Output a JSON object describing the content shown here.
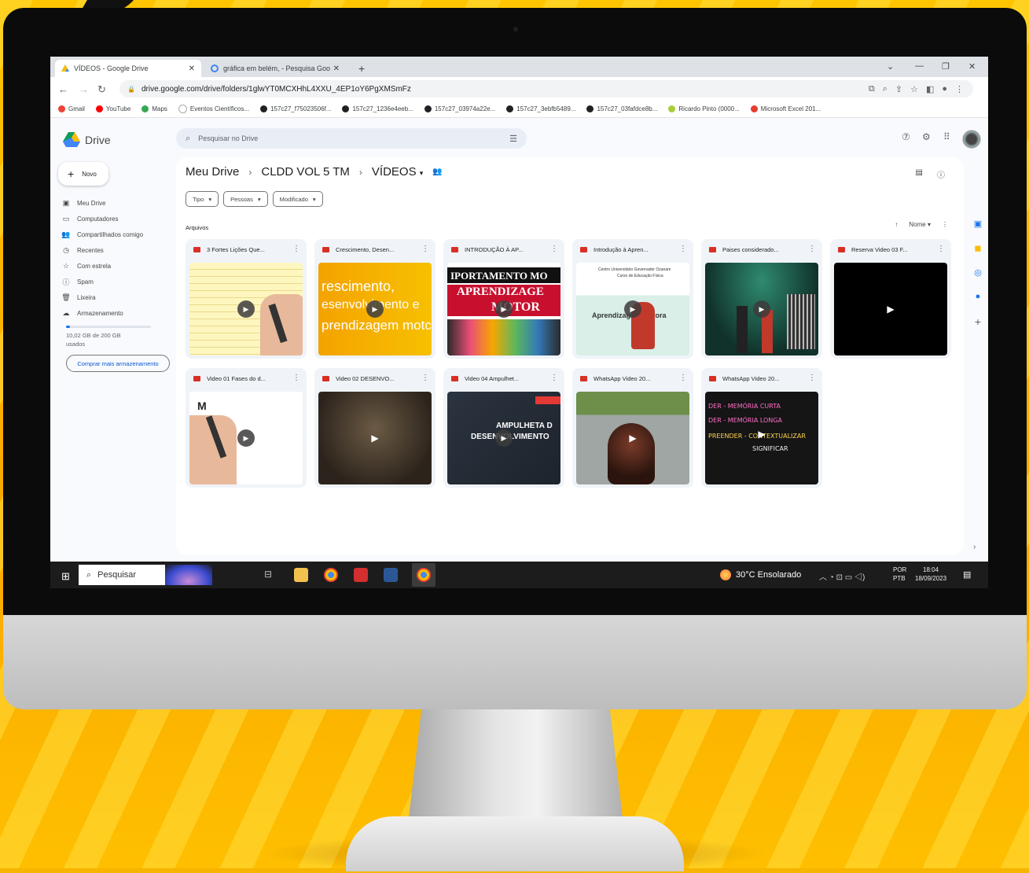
{
  "browser": {
    "tabs": [
      {
        "label": "VÍDEOS - Google Drive",
        "active": true
      },
      {
        "label": "gráfica em belém, - Pesquisa Goo",
        "active": false
      }
    ],
    "new_tab": "+",
    "url": "drive.google.com/drive/folders/1glwYT0MCXHhL4XXU_4EP1oY6PgXMSmFz",
    "bookmarks": [
      {
        "label": "Gmail",
        "color": "#ea4335"
      },
      {
        "label": "YouTube",
        "color": "#ff0000"
      },
      {
        "label": "Maps",
        "color": "#34a853"
      },
      {
        "label": "Eventos Científicos...",
        "color": "#ffffff"
      },
      {
        "label": "157c27_f75023506f...",
        "color": "#202124"
      },
      {
        "label": "157c27_1236e4eeb...",
        "color": "#202124"
      },
      {
        "label": "157c27_03974a22e...",
        "color": "#202124"
      },
      {
        "label": "157c27_3ebfb5489...",
        "color": "#202124"
      },
      {
        "label": "157c27_03fafdce8b...",
        "color": "#202124"
      },
      {
        "label": "Ricardo Pinto (0000...",
        "color": "#a6ce39"
      },
      {
        "label": "Microsoft Excel 201...",
        "color": "#e63d2e"
      }
    ]
  },
  "drive": {
    "logo_text": "Drive",
    "search_placeholder": "Pesquisar no Drive",
    "new_label": "Novo",
    "sidebar": [
      {
        "label": "Meu Drive",
        "icon": "▣"
      },
      {
        "label": "Computadores",
        "icon": "▭"
      },
      {
        "label": "Compartilhados comigo",
        "icon": "👥"
      },
      {
        "label": "Recentes",
        "icon": "◷"
      },
      {
        "label": "Com estrela",
        "icon": "☆"
      },
      {
        "label": "Spam",
        "icon": "ⓘ"
      },
      {
        "label": "Lixeira",
        "icon": "🗑"
      },
      {
        "label": "Armazenamento",
        "icon": "☁"
      }
    ],
    "storage_used_fraction": 0.05,
    "storage_text": "10,02 GB de 200 GB usados",
    "buy_storage": "Comprar mais armazenamento",
    "breadcrumb": [
      "Meu Drive",
      "CLDD VOL 5 TM",
      "VÍDEOS"
    ],
    "filters": [
      "Tipo",
      "Pessoas",
      "Modificado"
    ],
    "section_label": "Arquivos",
    "sort_label": "Nome",
    "files": [
      {
        "title": "3 Fortes Lições Que..."
      },
      {
        "title": "Crescimento, Desen..."
      },
      {
        "title": "INTRODUÇÃO À AP..."
      },
      {
        "title": "Introdução à Apren..."
      },
      {
        "title": "Paises considerado..."
      },
      {
        "title": "Reserva Video 03 F..."
      },
      {
        "title": "Video 01 Fases do d..."
      },
      {
        "title": "Video 02 DESENVO..."
      },
      {
        "title": "Video 04 Ampulhet..."
      },
      {
        "title": "WhatsApp Video 20..."
      },
      {
        "title": "WhatsApp Video 20..."
      }
    ],
    "thumb_texts": {
      "crescimento": [
        "rescimento,",
        "esenvolvimento e",
        "prendizagem motc"
      ],
      "intro_ap": [
        "IPORTAMENTO MO",
        "APRENDIZAGE",
        "MOTOR"
      ],
      "intro_apren": [
        "Centro Universitário Governador Ozanam",
        "Curso de Educação Física",
        "Aprendizagem Motora"
      ],
      "ampulheta": [
        "AMPULHETA D",
        "DESENVOLVIMENTO"
      ],
      "board": [
        "DER - MEMÓRIA CURTA",
        "DER - MEMÓRIA LONGA",
        "PREENDER - CONTEXTUALIZAR",
        "SIGNIFICAR"
      ],
      "video01": "M"
    }
  },
  "taskbar": {
    "search_label": "Pesquisar",
    "weather": "30°C  Ensolarado",
    "lang_top": "POR",
    "lang_bottom": "PTB",
    "time": "18:04",
    "date": "18/09/2023"
  }
}
